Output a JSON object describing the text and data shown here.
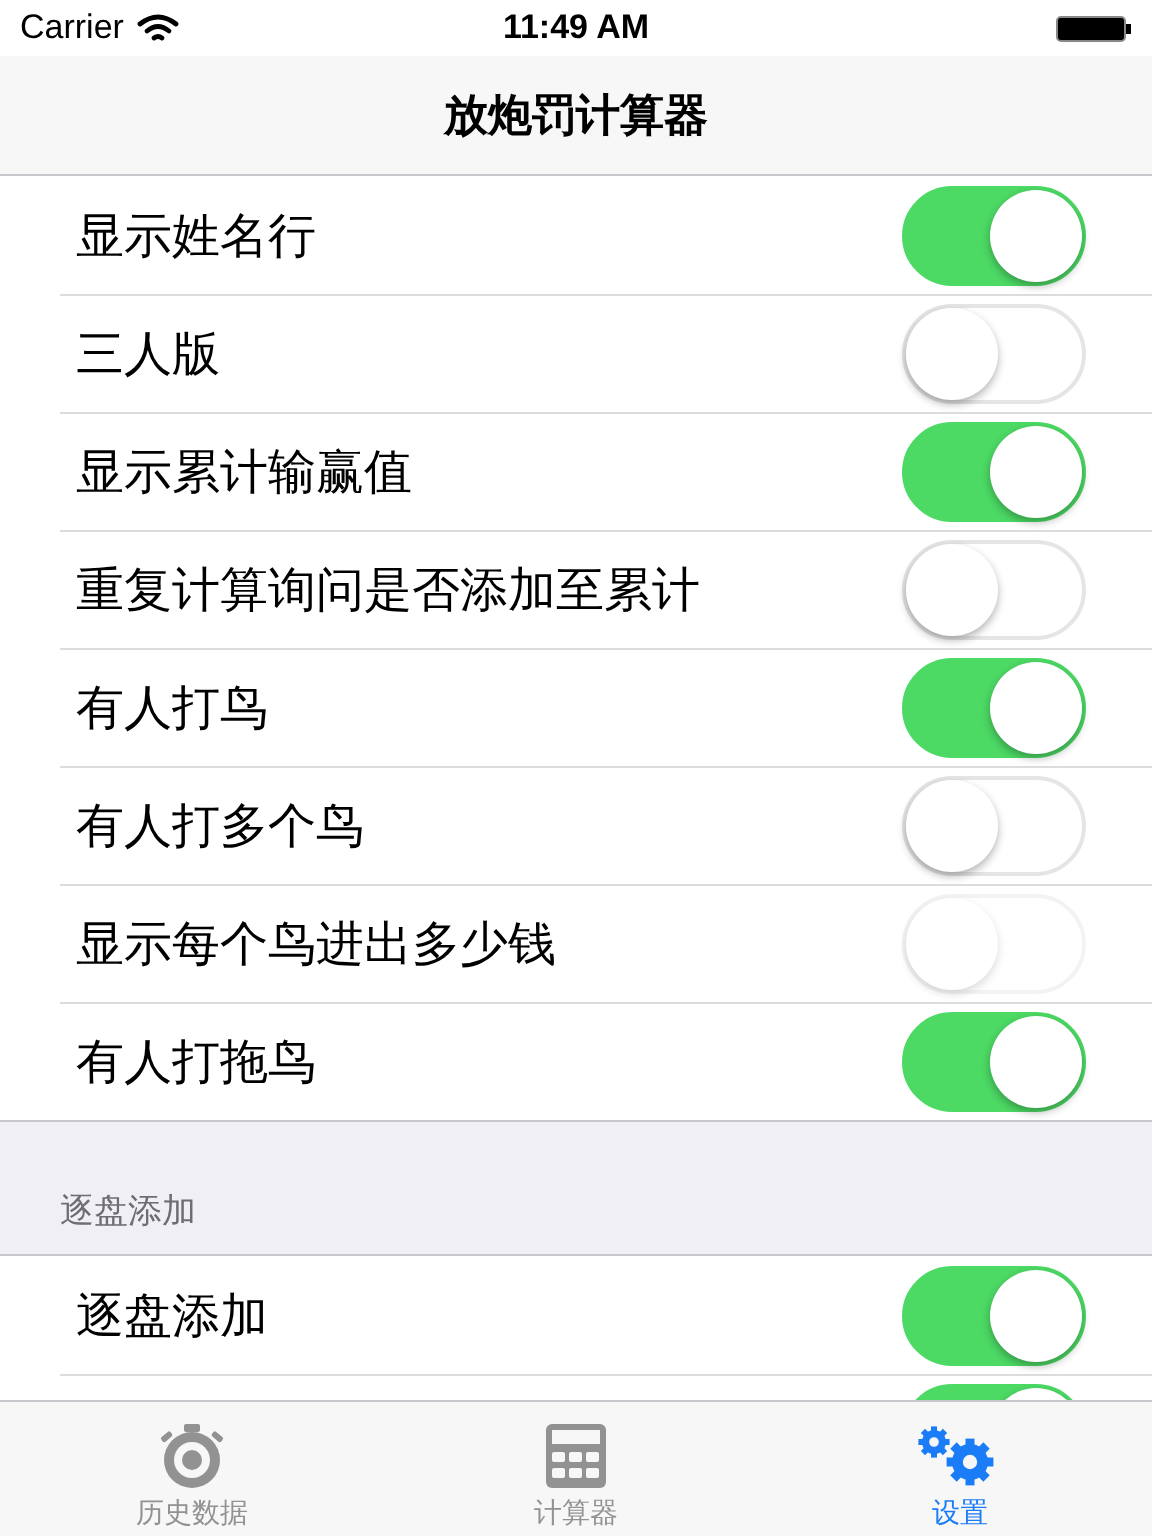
{
  "status_bar": {
    "carrier": "Carrier",
    "time": "11:49 AM"
  },
  "nav": {
    "title": "放炮罚计算器"
  },
  "sections": [
    {
      "rows": [
        {
          "label": "显示姓名行",
          "on": true,
          "disabled": false
        },
        {
          "label": "三人版",
          "on": false,
          "disabled": false
        },
        {
          "label": "显示累计输赢值",
          "on": true,
          "disabled": false
        },
        {
          "label": "重复计算询问是否添加至累计",
          "on": false,
          "disabled": false
        },
        {
          "label": "有人打鸟",
          "on": true,
          "disabled": false
        },
        {
          "label": "有人打多个鸟",
          "on": false,
          "disabled": false
        },
        {
          "label": "显示每个鸟进出多少钱",
          "on": false,
          "disabled": true
        },
        {
          "label": "有人打拖鸟",
          "on": true,
          "disabled": false
        }
      ]
    },
    {
      "header": "逐盘添加",
      "rows": [
        {
          "label": "逐盘添加",
          "on": true,
          "disabled": false
        },
        {
          "on": true,
          "disabled": false
        }
      ]
    }
  ],
  "tab_bar": {
    "items": [
      {
        "label": "历史数据",
        "kind": "stopwatch",
        "selected": false
      },
      {
        "label": "计算器",
        "kind": "calculator",
        "selected": false
      },
      {
        "label": "设置",
        "kind": "gears",
        "selected": true
      }
    ]
  }
}
